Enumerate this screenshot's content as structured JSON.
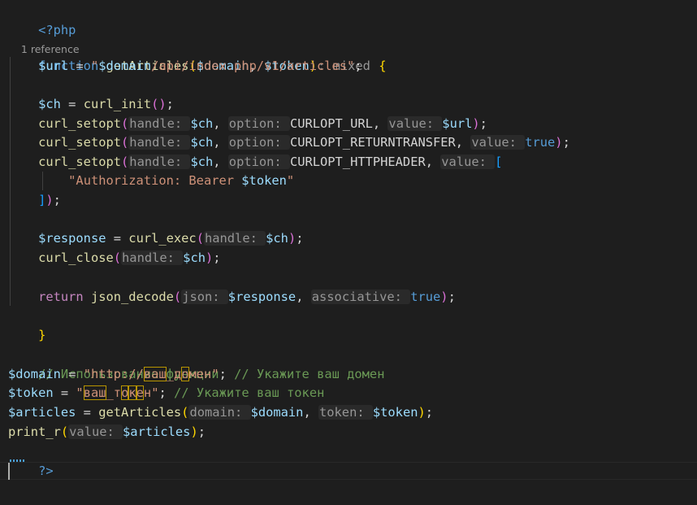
{
  "editor": {
    "codelens": "1 reference",
    "lines": {
      "l1": {
        "open_tag": "<?php"
      },
      "l2": {
        "kw": "function",
        "name": "getArticles",
        "paren_open": "(",
        "p1": "$domain",
        "comma": ", ",
        "p2": "$token",
        "paren_close": ")",
        "colon": ": ",
        "ret_type": "mixed",
        "brace": "{"
      },
      "l3": {
        "var": "$url",
        "eq": " = ",
        "q1": "\"",
        "interp": "$domain",
        "rest": "/api/index.php/v1/articles",
        "q2": "\"",
        "semi": ";"
      },
      "l5": {
        "var": "$ch",
        "eq": " = ",
        "fn": "curl_init",
        "parens": "()",
        "semi": ";"
      },
      "l6": {
        "fn": "curl_setopt",
        "po": "(",
        "h1": "handle: ",
        "a1": "$ch",
        "c1": ", ",
        "h2": "option: ",
        "a2": "CURLOPT_URL",
        "c2": ", ",
        "h3": "value: ",
        "a3": "$url",
        "pc": ")",
        "semi": ";"
      },
      "l7": {
        "fn": "curl_setopt",
        "po": "(",
        "h1": "handle: ",
        "a1": "$ch",
        "c1": ", ",
        "h2": "option: ",
        "a2": "CURLOPT_RETURNTRANSFER",
        "c2": ", ",
        "h3": "value: ",
        "a3": "true",
        "pc": ")",
        "semi": ";"
      },
      "l8": {
        "fn": "curl_setopt",
        "po": "(",
        "h1": "handle: ",
        "a1": "$ch",
        "c1": ", ",
        "h2": "option: ",
        "a2": "CURLOPT_HTTPHEADER",
        "c2": ", ",
        "h3": "value: ",
        "bracket": "["
      },
      "l9": {
        "q1": "\"",
        "text": "Authorization: Bearer ",
        "interp": "$token",
        "q2": "\""
      },
      "l10": {
        "bracket": "]",
        "pc": ")",
        "semi": ";"
      },
      "l12": {
        "var": "$response",
        "eq": " = ",
        "fn": "curl_exec",
        "po": "(",
        "h1": "handle: ",
        "a1": "$ch",
        "pc": ")",
        "semi": ";"
      },
      "l13": {
        "fn": "curl_close",
        "po": "(",
        "h1": "handle: ",
        "a1": "$ch",
        "pc": ")",
        "semi": ";"
      },
      "l15": {
        "kw": "return",
        "sp": " ",
        "fn": "json_decode",
        "po": "(",
        "h1": "json: ",
        "a1": "$response",
        "c1": ", ",
        "h2": "associative: ",
        "a2": "true",
        "pc": ")",
        "semi": ";"
      },
      "l16": {
        "brace": "}"
      },
      "l18": {
        "comment": "// Использование функции"
      },
      "l19": {
        "var": "$domain",
        "eq": " = ",
        "q1": "\"",
        "s1": "http://",
        "s2": "ваш",
        "s3": "_",
        "s4": "д",
        "s5": "о",
        "s6": "мен",
        "q2": "\"",
        "semi": "; ",
        "comment": "// Укажите ваш домен"
      },
      "l20": {
        "var": "$token",
        "eq": " = ",
        "q1": "\"",
        "s1": "ваш",
        "s2": "_",
        "s3": "т",
        "s4": "о",
        "s5": "к",
        "s6": "е",
        "s7": "н",
        "q2": "\"",
        "semi": "; ",
        "comment": "// Укажите ваш токен"
      },
      "l21": {
        "var": "$articles",
        "eq": " = ",
        "fn": "getArticles",
        "po": "(",
        "h1": "domain: ",
        "a1": "$domain",
        "c1": ", ",
        "h2": "token: ",
        "a2": "$token",
        "pc": ")",
        "semi": ";"
      },
      "l22": {
        "fn": "print_r",
        "po": "(",
        "h1": "value: ",
        "a1": "$articles",
        "pc": ")",
        "semi": ";"
      },
      "l23": {
        "close_tag": "?>"
      }
    }
  },
  "colors": {
    "background": "#1e1e1e",
    "keyword": "#569cd6",
    "control": "#c586c0",
    "function": "#dcdcaa",
    "variable": "#9cdcfe",
    "string": "#ce9178",
    "comment": "#6a9955",
    "bracket_gold": "#ffd700",
    "bracket_purple": "#da70d6",
    "bracket_blue": "#179fff"
  }
}
